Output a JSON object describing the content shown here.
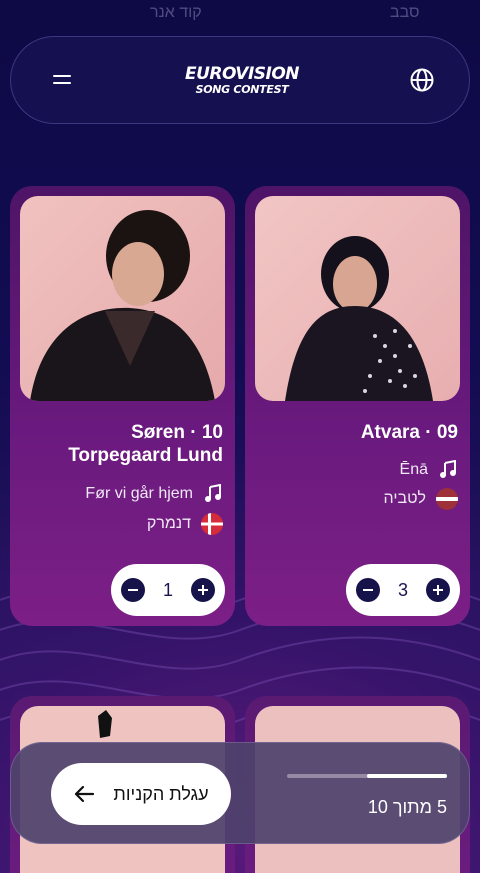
{
  "header": {
    "logo_line1": "EUROVISION",
    "logo_line2": "SONG CONTEST"
  },
  "top_strip": {
    "left_text": "סבב",
    "right_text": "קוד אנר"
  },
  "cards": [
    {
      "title": "Atvara · 09",
      "song": "Ēnā",
      "country": "לטביה",
      "quantity": "3"
    },
    {
      "title": "Søren · 10 Torpegaard Lund",
      "song": "Før vi går hjem",
      "country": "דנמרק",
      "quantity": "1"
    }
  ],
  "cart": {
    "button_label": "עגלת הקניות",
    "count_text": "5 מתוך 10",
    "progress_fraction": 0.5
  },
  "colors": {
    "background": "#0f0b4a",
    "card": "#6a1a7e",
    "accent": "#16124a"
  }
}
